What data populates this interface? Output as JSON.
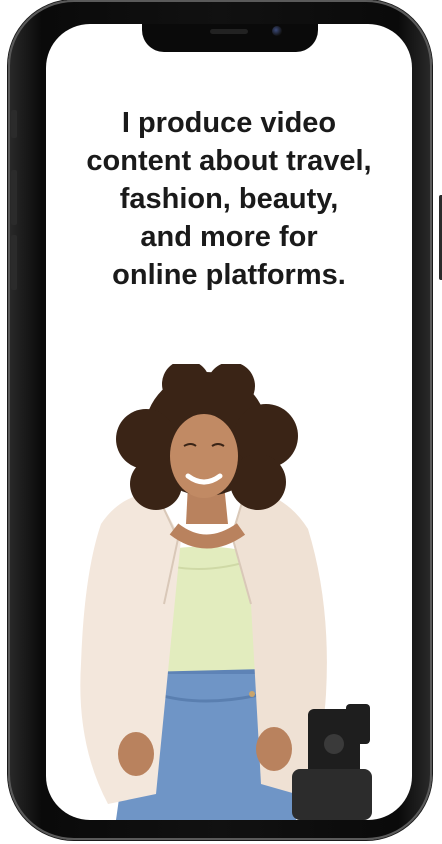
{
  "headline": {
    "lines": [
      "I produce video",
      "content about travel,",
      "fashion, beauty,",
      "and more for",
      "online platforms."
    ]
  },
  "colors": {
    "frame": "#0a0a0a",
    "screen": "#ffffff",
    "text": "#1a1a1a",
    "blazer": "#f3e7dc",
    "top": "#e2ecbe",
    "jeans": "#6f95c6",
    "hair": "#3a2416",
    "skin": "#b9825e"
  },
  "photo": {
    "subject": "smiling woman with curly hair in cream blazer and jeans",
    "props": [
      "camera-on-tripod"
    ]
  }
}
